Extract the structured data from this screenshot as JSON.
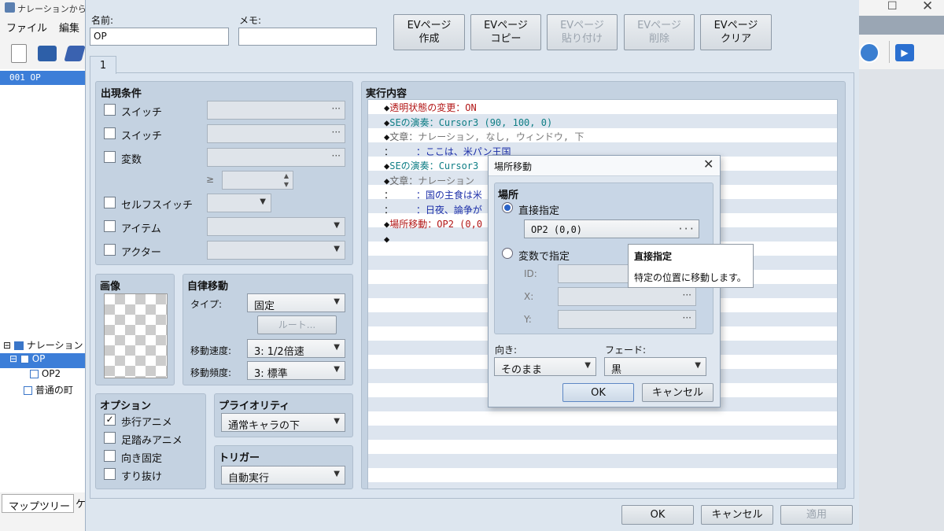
{
  "app": {
    "title": "ナレーションから始ま",
    "menu": [
      "ファイル",
      "編集"
    ],
    "map_list_selected": "001 OP",
    "tree": [
      {
        "label": "ナレーション"
      },
      {
        "label": "OP"
      },
      {
        "label": "OP2"
      },
      {
        "label": "普通の町"
      }
    ],
    "bottom_tab": "マップツリー",
    "bottom_tab2": "ケ"
  },
  "editor": {
    "name_label": "名前:",
    "name_value": "OP",
    "memo_label": "メモ:",
    "memo_value": "",
    "ev_buttons": [
      {
        "line1": "EVページ",
        "line2": "作成",
        "enabled": true
      },
      {
        "line1": "EVページ",
        "line2": "コピー",
        "enabled": true
      },
      {
        "line1": "EVページ",
        "line2": "貼り付け",
        "enabled": false
      },
      {
        "line1": "EVページ",
        "line2": "削除",
        "enabled": false
      },
      {
        "line1": "EVページ",
        "line2": "クリア",
        "enabled": true
      }
    ],
    "page_tab": "1",
    "conditions": {
      "title": "出現条件",
      "switch1": "スイッチ",
      "switch2": "スイッチ",
      "variable": "変数",
      "ge": "≥",
      "self_switch": "セルフスイッチ",
      "item": "アイテム",
      "actor": "アクター"
    },
    "image": {
      "title": "画像"
    },
    "autonomous": {
      "title": "自律移動",
      "type_label": "タイプ:",
      "type_value": "固定",
      "route_button": "ルート...",
      "speed_label": "移動速度:",
      "speed_value": "3: 1/2倍速",
      "freq_label": "移動頻度:",
      "freq_value": "3: 標準"
    },
    "options": {
      "title": "オプション",
      "walking": {
        "label": "歩行アニメ",
        "checked": true
      },
      "stepping": {
        "label": "足踏みアニメ",
        "checked": false
      },
      "dir_fix": {
        "label": "向き固定",
        "checked": false
      },
      "through": {
        "label": "すり抜け",
        "checked": false
      }
    },
    "priority": {
      "title": "プライオリティ",
      "value": "通常キャラの下"
    },
    "trigger": {
      "title": "トリガー",
      "value": "自動実行"
    },
    "contents": {
      "title": "実行内容",
      "lines": [
        {
          "prefix": "◆",
          "cmd": "透明状態の変更：ON",
          "args": "",
          "color": "#b21616"
        },
        {
          "prefix": "◆",
          "cmd": "SEの演奏：",
          "args": "Cursor3 (90, 100, 0)",
          "color": "#0f7e85"
        },
        {
          "prefix": "◆",
          "cmd": "文章：",
          "args": "ナレーション, なし, ウィンドウ, 下",
          "color": "#666666"
        },
        {
          "prefix": "：",
          "cmd": "    ：",
          "args": "ここは、米パン王国",
          "color": "#1b2ea8"
        },
        {
          "prefix": "◆",
          "cmd": "SEの演奏：",
          "args": "Cursor3",
          "color": "#0f7e85"
        },
        {
          "prefix": "◆",
          "cmd": "文章：",
          "args": "ナレーション",
          "color": "#666666"
        },
        {
          "prefix": "：",
          "cmd": "    ：",
          "args": "国の主食は米",
          "color": "#1b2ea8"
        },
        {
          "prefix": "：",
          "cmd": "    ：",
          "args": "日夜、論争が",
          "color": "#1b2ea8"
        },
        {
          "prefix": "◆",
          "cmd": "場所移動：",
          "args": "OP2 (0,0",
          "color": "#b21616"
        },
        {
          "prefix": "◆",
          "cmd": "",
          "args": "",
          "color": "#111111"
        }
      ]
    },
    "footer": {
      "ok": "OK",
      "cancel": "キャンセル",
      "apply": "適用"
    }
  },
  "transfer": {
    "title": "場所移動",
    "location_label": "場所",
    "direct_label": "直接指定",
    "direct_value": "OP2 (0,0)",
    "var_label": "変数で指定",
    "id_label": "ID:",
    "x_label": "X:",
    "y_label": "Y:",
    "direction_label": "向き:",
    "direction_value": "そのまま",
    "fade_label": "フェード:",
    "fade_value": "黒",
    "ok": "OK",
    "cancel": "キャンセル"
  },
  "tooltip": {
    "title": "直接指定",
    "text": "特定の位置に移動します。"
  }
}
